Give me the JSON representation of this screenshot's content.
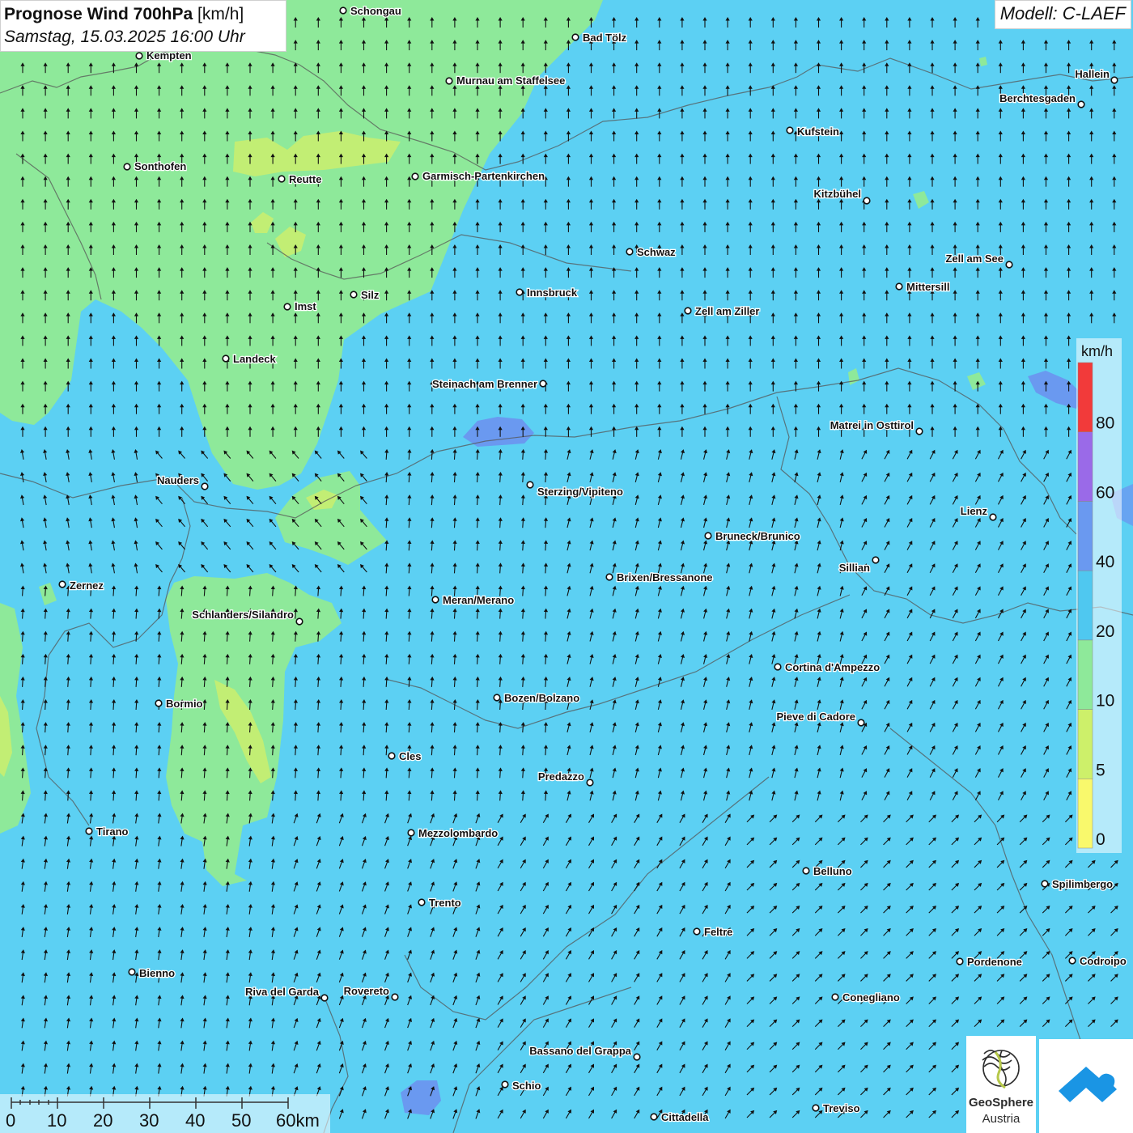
{
  "header": {
    "title_bold": "Prognose Wind 700hPa",
    "title_unit": "[km/h]",
    "datetime": "Samstag, 15.03.2025 16:00 Uhr",
    "model": "Modell: C-LAEF"
  },
  "legend": {
    "unit": "km/h",
    "classes": [
      {
        "label": "0",
        "color": "#f9f96c"
      },
      {
        "label": "5",
        "color": "#cdf06a"
      },
      {
        "label": "10",
        "color": "#8ee99a"
      },
      {
        "label": "20",
        "color": "#4fc8f0"
      },
      {
        "label": "40",
        "color": "#6a99f0"
      },
      {
        "label": "60",
        "color": "#9a6ae8"
      },
      {
        "label": "80",
        "color": "#f23a3a"
      }
    ]
  },
  "scalebar": {
    "labels": [
      "0",
      "10",
      "20",
      "30",
      "40",
      "50",
      "60km"
    ]
  },
  "cities": [
    {
      "name": "Schongau"
    },
    {
      "name": "Kempten"
    },
    {
      "name": "Bad Tölz"
    },
    {
      "name": "Murnau am Staffelsee"
    },
    {
      "name": "Hallein"
    },
    {
      "name": "Berchtesgaden"
    },
    {
      "name": "Kufstein"
    },
    {
      "name": "Sonthofen"
    },
    {
      "name": "Reutte"
    },
    {
      "name": "Garmisch-Partenkirchen"
    },
    {
      "name": "Kitzbühel"
    },
    {
      "name": "Schwaz"
    },
    {
      "name": "Zell am See"
    },
    {
      "name": "Mittersill"
    },
    {
      "name": "Innsbruck"
    },
    {
      "name": "Silz"
    },
    {
      "name": "Imst"
    },
    {
      "name": "Zell am Ziller"
    },
    {
      "name": "Landeck"
    },
    {
      "name": "Steinach am Brenner"
    },
    {
      "name": "Matrei in Osttirol"
    },
    {
      "name": "Nauders"
    },
    {
      "name": "Sterzing/Vipiteno"
    },
    {
      "name": "Lienz"
    },
    {
      "name": "Bruneck/Brunico"
    },
    {
      "name": "Sillian"
    },
    {
      "name": "Zernez"
    },
    {
      "name": "Brixen/Bressanone"
    },
    {
      "name": "Meran/Merano"
    },
    {
      "name": "Schlanders/Silandro"
    },
    {
      "name": "Cortina d'Ampezzo"
    },
    {
      "name": "Bormio"
    },
    {
      "name": "Bozen/Bolzano"
    },
    {
      "name": "Pieve di Cadore"
    },
    {
      "name": "Cles"
    },
    {
      "name": "Predazzo"
    },
    {
      "name": "Tirano"
    },
    {
      "name": "Mezzolombardo"
    },
    {
      "name": "Belluno"
    },
    {
      "name": "Spilimbergo"
    },
    {
      "name": "Trento"
    },
    {
      "name": "Feltre"
    },
    {
      "name": "Pordenone"
    },
    {
      "name": "Codroipo"
    },
    {
      "name": "Bienno"
    },
    {
      "name": "Riva del Garda"
    },
    {
      "name": "Rovereto"
    },
    {
      "name": "Conegliano"
    },
    {
      "name": "Bassano del Grappa"
    },
    {
      "name": "Schio"
    },
    {
      "name": "Treviso"
    },
    {
      "name": "Cittadella"
    }
  ],
  "logos": {
    "geosphere_line1": "GeoSphere",
    "geosphere_line2": "Austria"
  },
  "colors": {
    "base_wind": "#5cd0f3",
    "light_wind": "#8ee99a",
    "very_light_wind": "#c8ee70",
    "strong_wind": "#6a99f0",
    "border": "#555555",
    "logo_blue": "#1a95e4"
  }
}
